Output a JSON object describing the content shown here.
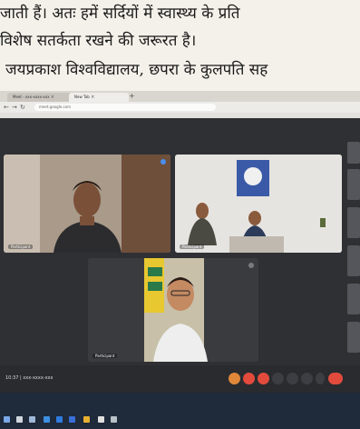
{
  "article": {
    "line1": "जाती हैं। अतः हमें सर्दियों में स्वास्थ्य के प्रति",
    "line2": "विशेष सतर्कता रखने की जरूरत है।",
    "line3": "जयप्रकाश विश्वविद्यालय, छपरा के कुलपति सह"
  },
  "browser": {
    "tabs": [
      {
        "label": "Meet - xxx-xxxx-xxx"
      },
      {
        "label": "New Tab"
      }
    ],
    "tab_close": "×",
    "new_tab": "+",
    "url": "meet.google.com"
  },
  "meeting": {
    "participants": [
      {
        "name": "Participant"
      },
      {
        "name": "Participant"
      },
      {
        "name": "Participant"
      }
    ],
    "time_code": "10:37 | xxx-xxxx-xxx",
    "controls": [
      {
        "icon": "reactions-icon"
      },
      {
        "icon": "microphone-icon"
      },
      {
        "icon": "camera-icon"
      },
      {
        "icon": "captions-icon"
      },
      {
        "icon": "raise-hand-icon"
      },
      {
        "icon": "present-icon"
      },
      {
        "icon": "more-options-icon"
      },
      {
        "icon": "end-call-icon"
      }
    ]
  },
  "colors": {
    "end_call": "#e24b3c",
    "meet_background": "#2f3034",
    "taskbar": "#1f2a3a"
  }
}
